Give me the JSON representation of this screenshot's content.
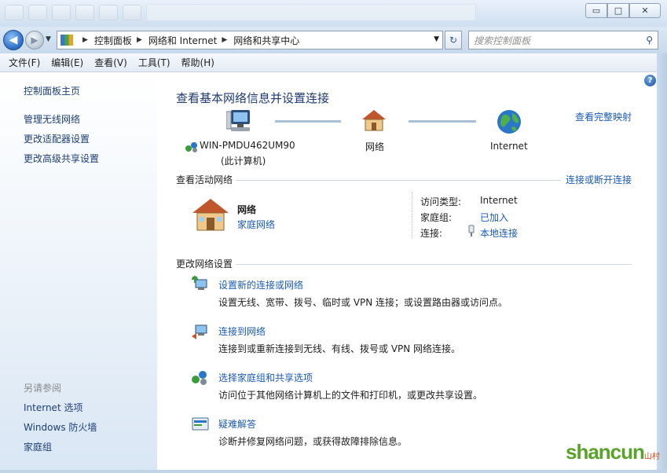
{
  "window": {
    "caption": {
      "minimize": "▭",
      "maximize": "□",
      "close": "✕"
    }
  },
  "nav": {
    "back_glyph": "◀",
    "forward_glyph": "▶",
    "history_glyph": "▼",
    "breadcrumb": [
      "控制面板",
      "网络和 Internet",
      "网络和共享中心"
    ],
    "crumb_sep": "▶",
    "dropdown_glyph": "▼",
    "refresh_glyph": "↻",
    "search_placeholder": "搜索控制面板",
    "search_glyph": "⚲"
  },
  "menu": [
    "文件(F)",
    "编辑(E)",
    "查看(V)",
    "工具(T)",
    "帮助(H)"
  ],
  "sidebar": {
    "items": [
      "控制面板主页",
      "管理无线网络",
      "更改适配器设置",
      "更改高级共享设置"
    ],
    "see_also_label": "另请参阅",
    "see_also": [
      "Internet 选项",
      "Windows 防火墙",
      "家庭组"
    ]
  },
  "main": {
    "help_glyph": "?",
    "title": "查看基本网络信息并设置连接",
    "full_map_link": "查看完整映射",
    "map": {
      "computer_name": "WIN-PMDU462UM90",
      "computer_sub": "(此计算机)",
      "network": "网络",
      "internet": "Internet"
    },
    "active_networks": {
      "label": "查看活动网络",
      "connect_link": "连接或断开连接",
      "network_name": "网络",
      "network_type": "家庭网络",
      "props": [
        {
          "key": "访问类型:",
          "value": "Internet"
        },
        {
          "key": "家庭组:",
          "value": "已加入"
        },
        {
          "key": "连接:",
          "value": "本地连接"
        }
      ]
    },
    "change_settings": {
      "label": "更改网络设置",
      "tasks": [
        {
          "title": "设置新的连接或网络",
          "desc": "设置无线、宽带、拨号、临时或 VPN 连接；或设置路由器或访问点。"
        },
        {
          "title": "连接到网络",
          "desc": "连接到或重新连接到无线、有线、拨号或 VPN 网络连接。"
        },
        {
          "title": "选择家庭组和共享选项",
          "desc": "访问位于其他网络计算机上的文件和打印机，或更改共享设置。"
        },
        {
          "title": "疑难解答",
          "desc": "诊断并修复网络问题，或获得故障排除信息。"
        }
      ]
    }
  },
  "watermark": {
    "main": "shancun",
    "sub": "山村网.net"
  }
}
